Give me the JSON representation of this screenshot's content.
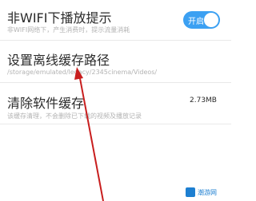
{
  "settings": {
    "wifi_play_prompt": {
      "title": "非WIFI下播放提示",
      "subtitle": "非WIFI网络下，产生消费时，提示流量消耗",
      "toggle_label": "开启",
      "toggle_on": true
    },
    "offline_cache_path": {
      "title": "设置离线缓存路径",
      "subtitle": "/storage/emulated/legacy/2345cinema/Videos/"
    },
    "clear_cache": {
      "title": "清除软件缓存",
      "subtitle": "该缓存清理，不会删除已下载的视频及播放记录",
      "size": "2.73MB"
    }
  },
  "watermark": {
    "text": "潮游网"
  },
  "colors": {
    "accent": "#3ba0f2",
    "arrow": "#c81e1e",
    "divider": "#e9e9e9",
    "subtitle": "#b3b3b3"
  },
  "icons": {
    "annotation": "arrow-up-icon"
  }
}
